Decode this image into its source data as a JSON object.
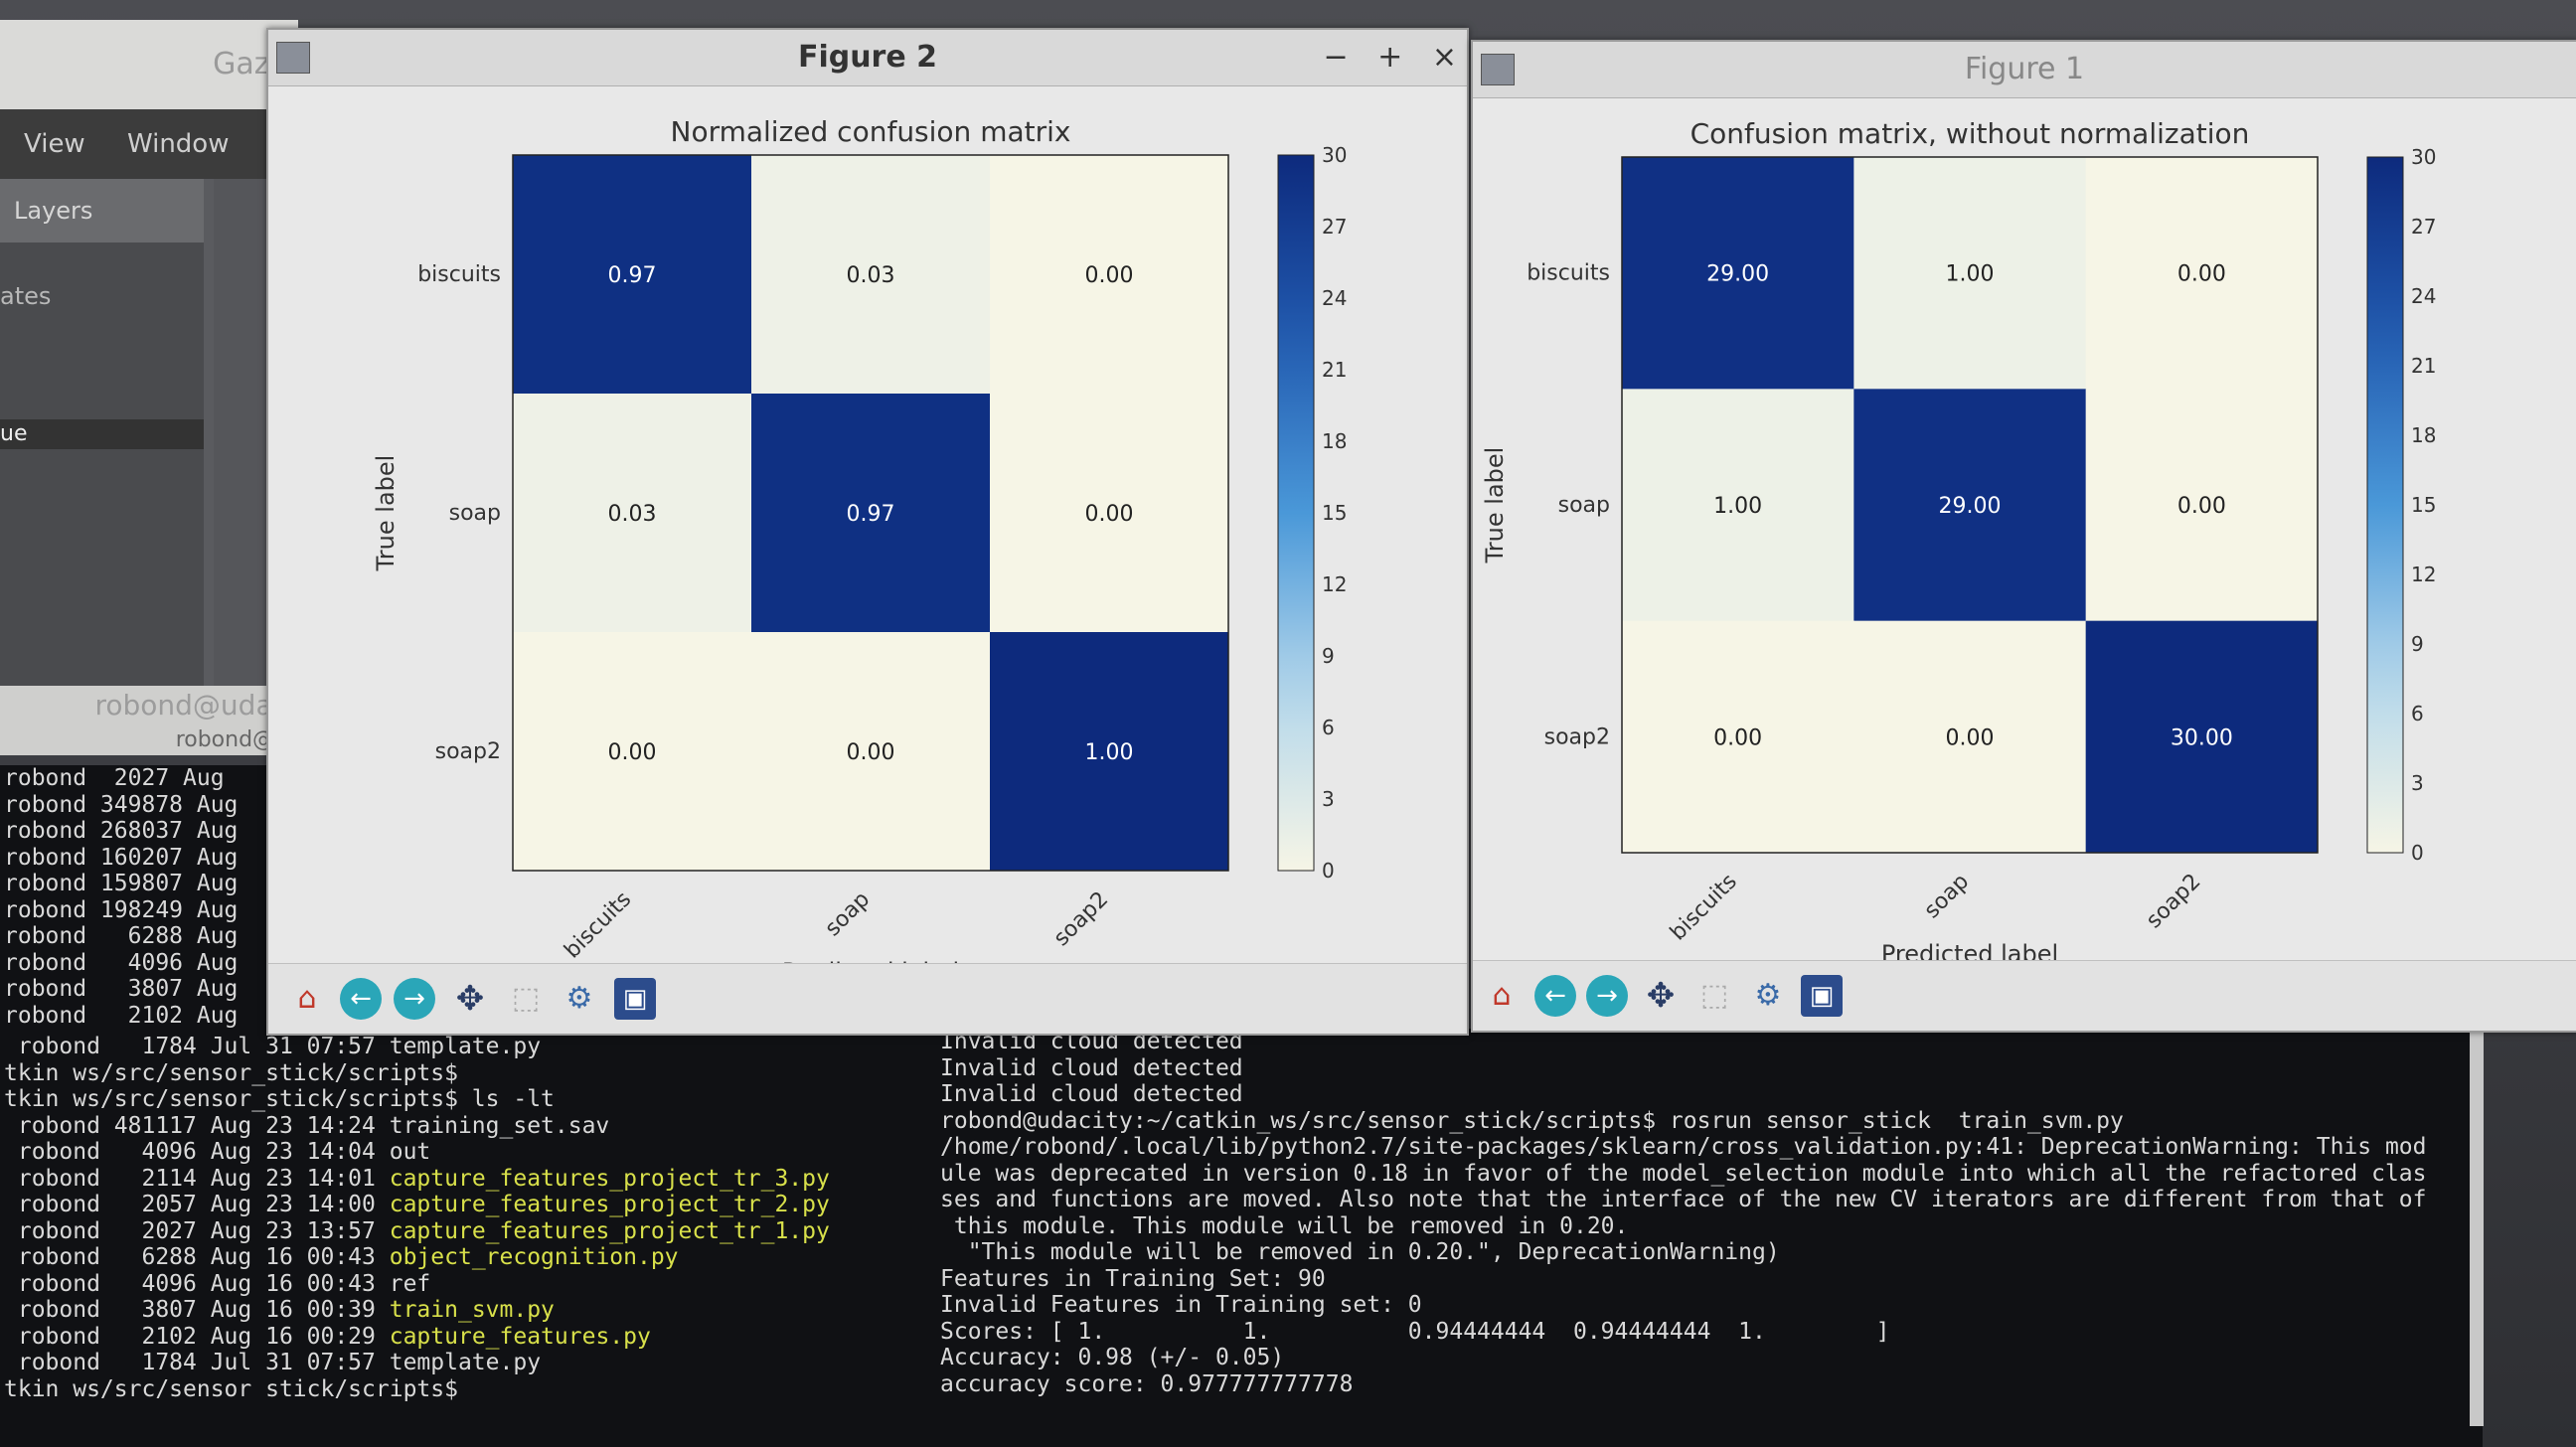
{
  "gazebo": {
    "title": "Gaze",
    "menu": [
      "View",
      "Window"
    ],
    "tab": "Layers",
    "row": "ates",
    "selected": "ue"
  },
  "left_terminal_header": {
    "line1": "robond@udac",
    "line2": "robond@u"
  },
  "left_terminal_top": [
    "robond  2027 Aug",
    "robond 349878 Aug",
    "robond 268037 Aug",
    "robond 160207 Aug",
    "robond 159807 Aug",
    "robond 198249 Aug",
    "robond   6288 Aug",
    "robond   4096 Aug",
    "robond   3807 Aug",
    "robond   2102 Aug"
  ],
  "left_terminal": [
    {
      "text": " robond   1784 Jul 31 07:57 template.py",
      "green": false
    },
    {
      "text": "tkin ws/src/sensor_stick/scripts$",
      "green": false
    },
    {
      "text": "tkin ws/src/sensor_stick/scripts$ ls -lt",
      "green": false
    },
    {
      "text": "",
      "green": false
    },
    {
      "text": " robond 481117 Aug 23 14:24 training_set.sav",
      "green": false
    },
    {
      "text": " robond   4096 Aug 23 14:04 out",
      "green": false
    },
    {
      "text": " robond   2114 Aug 23 14:01 capture_features_project_tr_3.py",
      "green": true
    },
    {
      "text": " robond   2057 Aug 23 14:00 capture_features_project_tr_2.py",
      "green": true
    },
    {
      "text": " robond   2027 Aug 23 13:57 capture_features_project_tr_1.py",
      "green": true
    },
    {
      "text": " robond   6288 Aug 16 00:43 object_recognition.py",
      "green": true
    },
    {
      "text": " robond   4096 Aug 16 00:43 ref",
      "green": false
    },
    {
      "text": " robond   3807 Aug 16 00:39 train_svm.py",
      "green": true
    },
    {
      "text": " robond   2102 Aug 16 00:29 capture_features.py",
      "green": true
    },
    {
      "text": " robond   1784 Jul 31 07:57 template.py",
      "green": false
    },
    {
      "text": "tkin ws/src/sensor stick/scripts$ ",
      "green": false
    }
  ],
  "right_terminal": [
    "Invalid cloud detected",
    "Invalid cloud detected",
    "Invalid cloud detected",
    "robond@udacity:~/catkin_ws/src/sensor_stick/scripts$ rosrun sensor_stick  train_svm.py",
    "/home/robond/.local/lib/python2.7/site-packages/sklearn/cross_validation.py:41: DeprecationWarning: This mod",
    "ule was deprecated in version 0.18 in favor of the model_selection module into which all the refactored clas",
    "ses and functions are moved. Also note that the interface of the new CV iterators are different from that of",
    " this module. This module will be removed in 0.20.",
    "  \"This module will be removed in 0.20.\", DeprecationWarning)",
    "Features in Training Set: 90",
    "Invalid Features in Training set: 0",
    "Scores: [ 1.          1.          0.94444444  0.94444444  1.        ]",
    "Accuracy: 0.98 (+/- 0.05)",
    "accuracy score: 0.977777777778",
    ""
  ],
  "figure2": {
    "window_title": "Figure 2",
    "controls": [
      "−",
      "+",
      "×"
    ],
    "chart_data": {
      "type": "heatmap",
      "title": "Normalized confusion matrix",
      "xlabel": "Predicted label",
      "ylabel": "True label",
      "categories": [
        "biscuits",
        "soap",
        "soap2"
      ],
      "values": [
        [
          0.97,
          0.03,
          0.0
        ],
        [
          0.03,
          0.97,
          0.0
        ],
        [
          0.0,
          0.0,
          1.0
        ]
      ],
      "cell_labels": [
        [
          "0.97",
          "0.03",
          "0.00"
        ],
        [
          "0.03",
          "0.97",
          "0.00"
        ],
        [
          "0.00",
          "0.00",
          "1.00"
        ]
      ],
      "colorbar_ticks": [
        "0",
        "3",
        "6",
        "9",
        "12",
        "15",
        "18",
        "21",
        "24",
        "27",
        "30"
      ],
      "colorbar_range": [
        0,
        30
      ]
    }
  },
  "figure1": {
    "window_title": "Figure 1",
    "chart_data": {
      "type": "heatmap",
      "title": "Confusion matrix, without normalization",
      "xlabel": "Predicted label",
      "ylabel": "True label",
      "categories": [
        "biscuits",
        "soap",
        "soap2"
      ],
      "values": [
        [
          29,
          1,
          0
        ],
        [
          1,
          29,
          0
        ],
        [
          0,
          0,
          30
        ]
      ],
      "cell_labels": [
        [
          "29.00",
          "1.00",
          "0.00"
        ],
        [
          "1.00",
          "29.00",
          "0.00"
        ],
        [
          "0.00",
          "0.00",
          "30.00"
        ]
      ],
      "colorbar_ticks": [
        "0",
        "3",
        "6",
        "9",
        "12",
        "15",
        "18",
        "21",
        "24",
        "27",
        "30"
      ],
      "colorbar_range": [
        0,
        30
      ]
    }
  },
  "toolbar_icons": [
    "home-icon",
    "back-arrow-icon",
    "forward-arrow-icon",
    "pan-icon",
    "zoom-icon",
    "subplot-config-icon",
    "save-icon"
  ],
  "colors": {
    "dark_cell": "#0d2a7d",
    "light_cell": "#f6f5e6",
    "terminal_bg": "#101114",
    "terminal_green": "#d8e04a"
  }
}
